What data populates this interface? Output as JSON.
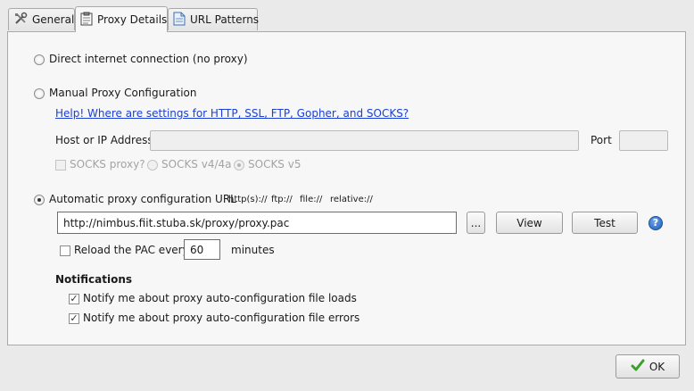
{
  "tabs": [
    {
      "label": "General",
      "icon": "tools-icon"
    },
    {
      "label": "Proxy Details",
      "icon": "clipboard-icon"
    },
    {
      "label": "URL Patterns",
      "icon": "document-icon"
    }
  ],
  "direct": {
    "label": "Direct internet connection (no proxy)"
  },
  "manual": {
    "label": "Manual Proxy Configuration",
    "help_link": "Help! Where are settings for HTTP, SSL, FTP, Gopher, and SOCKS?",
    "host_label": "Host or IP Address",
    "host_value": "",
    "port_label": "Port",
    "port_value": "",
    "socks_proxy_label": "SOCKS proxy?",
    "socks_v4_label": "SOCKS v4/4a",
    "socks_v5_label": "SOCKS v5"
  },
  "auto": {
    "label": "Automatic proxy configuration URL",
    "hints": [
      "http(s)://",
      "ftp://",
      "file://",
      "relative://"
    ],
    "url_value": "http://nimbus.fiit.stuba.sk/proxy/proxy.pac",
    "browse_label": "...",
    "view_label": "View",
    "test_label": "Test",
    "help_icon": "?",
    "reload_label": "Reload the PAC every",
    "reload_value": "60",
    "minutes_label": "minutes"
  },
  "notifications": {
    "heading": "Notifications",
    "loads_label": "Notify me about proxy auto-configuration file loads",
    "errors_label": "Notify me about proxy auto-configuration file errors"
  },
  "footer": {
    "ok_label": "OK"
  }
}
